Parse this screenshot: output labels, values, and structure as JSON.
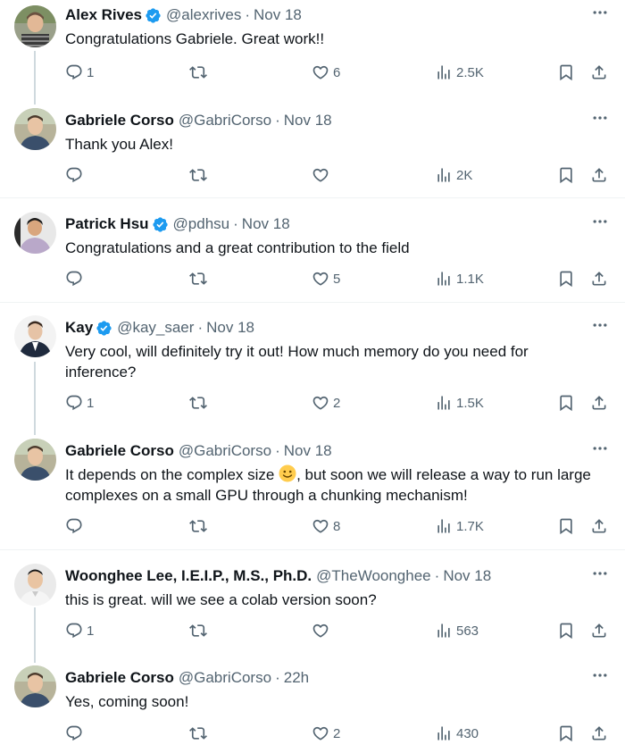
{
  "tweets": [
    {
      "name": "Alex Rives",
      "verified": true,
      "handle": "@alexrives",
      "time": "Nov 18",
      "text": "Congratulations Gabriele. Great work!!",
      "replies": "1",
      "retweets": "",
      "likes": "6",
      "views": "2.5K"
    },
    {
      "name": "Gabriele Corso",
      "verified": false,
      "handle": "@GabriCorso",
      "time": "Nov 18",
      "text": "Thank you Alex!",
      "replies": "",
      "retweets": "",
      "likes": "",
      "views": "2K"
    },
    {
      "name": "Patrick Hsu",
      "verified": true,
      "handle": "@pdhsu",
      "time": "Nov 18",
      "text": "Congratulations and a great contribution to the field",
      "replies": "",
      "retweets": "",
      "likes": "5",
      "views": "1.1K"
    },
    {
      "name": "Kay",
      "verified": true,
      "handle": "@kay_saer",
      "time": "Nov 18",
      "text": "Very cool, will definitely try it out! How much memory do you need for inference?",
      "replies": "1",
      "retweets": "",
      "likes": "2",
      "views": "1.5K"
    },
    {
      "name": "Gabriele Corso",
      "verified": false,
      "handle": "@GabriCorso",
      "time": "Nov 18",
      "text_before": "It depends on the complex size ",
      "text_after": ", but soon we will release a way to run large complexes on a small GPU through a chunking mechanism!",
      "replies": "",
      "retweets": "",
      "likes": "8",
      "views": "1.7K"
    },
    {
      "name": "Woonghee Lee, I.E.I.P., M.S., Ph.D.",
      "verified": false,
      "handle": "@TheWoonghee",
      "time": "Nov 18",
      "text": "this is great. will we see a colab version soon?",
      "replies": "1",
      "retweets": "",
      "likes": "",
      "views": "563"
    },
    {
      "name": "Gabriele Corso",
      "verified": false,
      "handle": "@GabriCorso",
      "time": "22h",
      "text": "Yes, coming soon!",
      "replies": "",
      "retweets": "",
      "likes": "2",
      "views": "430"
    }
  ],
  "separator": "·",
  "icons": {
    "reply": "reply-icon",
    "retweet": "retweet-icon",
    "like": "heart-icon",
    "views": "views-icon",
    "bookmark": "bookmark-icon",
    "share": "share-icon",
    "more": "more-icon",
    "verified": "verified-badge-icon"
  },
  "colors": {
    "text": "#0f1419",
    "secondary": "#536471",
    "verified": "#1d9bf0",
    "thread_line": "#cfd9de",
    "divider": "#eff3f4"
  }
}
